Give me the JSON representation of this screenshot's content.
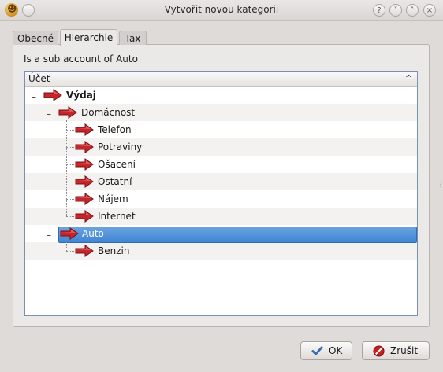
{
  "window": {
    "title": "Vytvořit novou kategorii",
    "controls": [
      "?",
      "˅",
      "˄",
      "×"
    ]
  },
  "tabs": [
    {
      "label": "Obecné",
      "active": false
    },
    {
      "label": "Hierarchie",
      "active": true
    },
    {
      "label": "Tax",
      "active": false
    }
  ],
  "subtitle": "Is a sub account of Auto",
  "tree": {
    "header": "Účet",
    "sort_icon": "^",
    "items": [
      {
        "label": "Výdaj",
        "level": 0,
        "bold": true,
        "expanded": true
      },
      {
        "label": "Domácnost",
        "level": 1,
        "expanded": true
      },
      {
        "label": "Telefon",
        "level": 2
      },
      {
        "label": "Potraviny",
        "level": 2
      },
      {
        "label": "Ošacení",
        "level": 2
      },
      {
        "label": "Ostatní",
        "level": 2
      },
      {
        "label": "Nájem",
        "level": 2
      },
      {
        "label": "Internet",
        "level": 2
      },
      {
        "label": "Auto",
        "level": 1,
        "expanded": true,
        "selected": true
      },
      {
        "label": "Benzin",
        "level": 2
      }
    ]
  },
  "buttons": {
    "ok": "OK",
    "cancel": "Zrušit"
  },
  "colors": {
    "selection": "#3f84d4",
    "arrow": "#c7252a",
    "ok_check": "#3a6ab0",
    "cancel": "#c51f1f"
  }
}
